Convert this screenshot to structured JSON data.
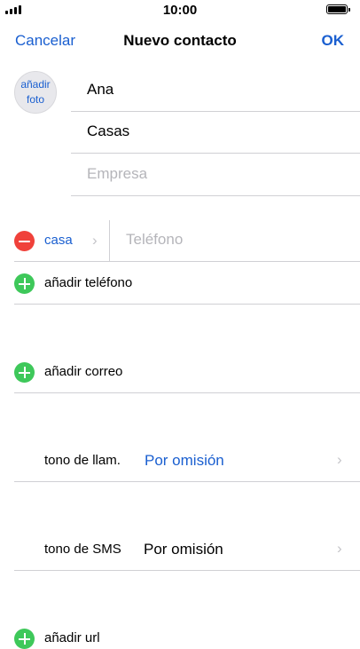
{
  "status": {
    "time": "10:00"
  },
  "nav": {
    "cancel": "Cancelar",
    "title": "Nuevo contacto",
    "done": "OK"
  },
  "photo": {
    "line1": "añadir",
    "line2": "foto"
  },
  "fields": {
    "first_name": "Ana",
    "last_name": "Casas",
    "company_placeholder": "Empresa"
  },
  "phone": {
    "label": "casa",
    "placeholder": "Teléfono",
    "add": "añadir teléfono"
  },
  "email": {
    "add": "añadir correo"
  },
  "ringtone": {
    "label": "tono de llam.",
    "value": "Por omisión"
  },
  "texttone": {
    "label": "tono de SMS",
    "value": "Por omisión"
  },
  "url": {
    "add": "añadir url"
  },
  "colors": {
    "accent": "#1a5fd0",
    "delete": "#f0413a",
    "add": "#3ec85a"
  }
}
